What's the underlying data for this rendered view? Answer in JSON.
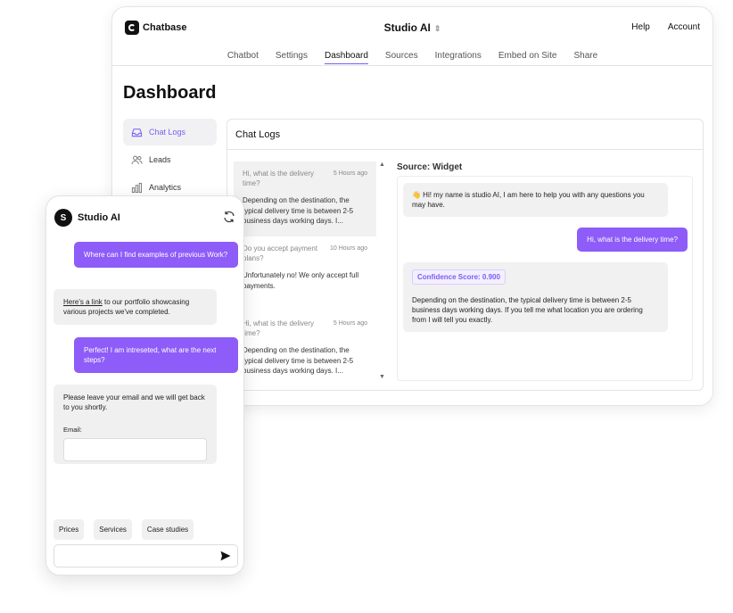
{
  "brand": {
    "name": "Chatbase"
  },
  "header": {
    "project": "Studio AI",
    "help": "Help",
    "account": "Account"
  },
  "tabs": [
    "Chatbot",
    "Settings",
    "Dashboard",
    "Sources",
    "Integrations",
    "Embed on Site",
    "Share"
  ],
  "active_tab": "Dashboard",
  "page_title": "Dashboard",
  "sidebar": {
    "items": [
      {
        "label": "Chat Logs",
        "icon": "inbox-icon",
        "active": true
      },
      {
        "label": "Leads",
        "icon": "users-icon"
      },
      {
        "label": "Analytics",
        "icon": "bar-chart-icon"
      }
    ]
  },
  "chat_logs": {
    "title": "Chat Logs",
    "items": [
      {
        "question": "Hi, what is the delivery time?",
        "time": "5 Hours ago",
        "answer": "Depending on the destination, the typical delivery time is between 2-5 business days working days. I..."
      },
      {
        "question": "Do you accept payment plans?",
        "time": "10 Hours ago",
        "answer": "Unfortunately no! We only accept full payments."
      },
      {
        "question": "Hi, what is the delivery time?",
        "time": "5 Hours ago",
        "answer": "Depending on the destination, the typical delivery time is between 2-5 business days working days. I..."
      }
    ]
  },
  "conversation": {
    "source": "Source: Widget",
    "greeting": "👋 Hi! my name is studio AI, I am here to help you with any questions you may have.",
    "user_message": "Hi, what is the delivery time?",
    "confidence": "Confidence Score: 0.900",
    "bot_answer": "Depending on the destination, the typical delivery time is between 2-5 business days working days. If you tell me what location you are ordering from I will tell you exactly."
  },
  "widget": {
    "name": "Studio AI",
    "avatar": "S",
    "messages": {
      "user1": "Where can I find examples of previous Work?",
      "bot1_link": "Here's a link",
      "bot1_rest": " to our portfolio showcasing various projects we've completed.",
      "user2": "Perfect! I am intreseted, what are the next steps?",
      "bot2": "Please leave your email and we will get back to you shortly."
    },
    "email_label": "Email:",
    "chips": [
      "Prices",
      "Services",
      "Case studies"
    ]
  },
  "colors": {
    "accent": "#8e5cf8",
    "accent_text": "#7c5cf6"
  }
}
